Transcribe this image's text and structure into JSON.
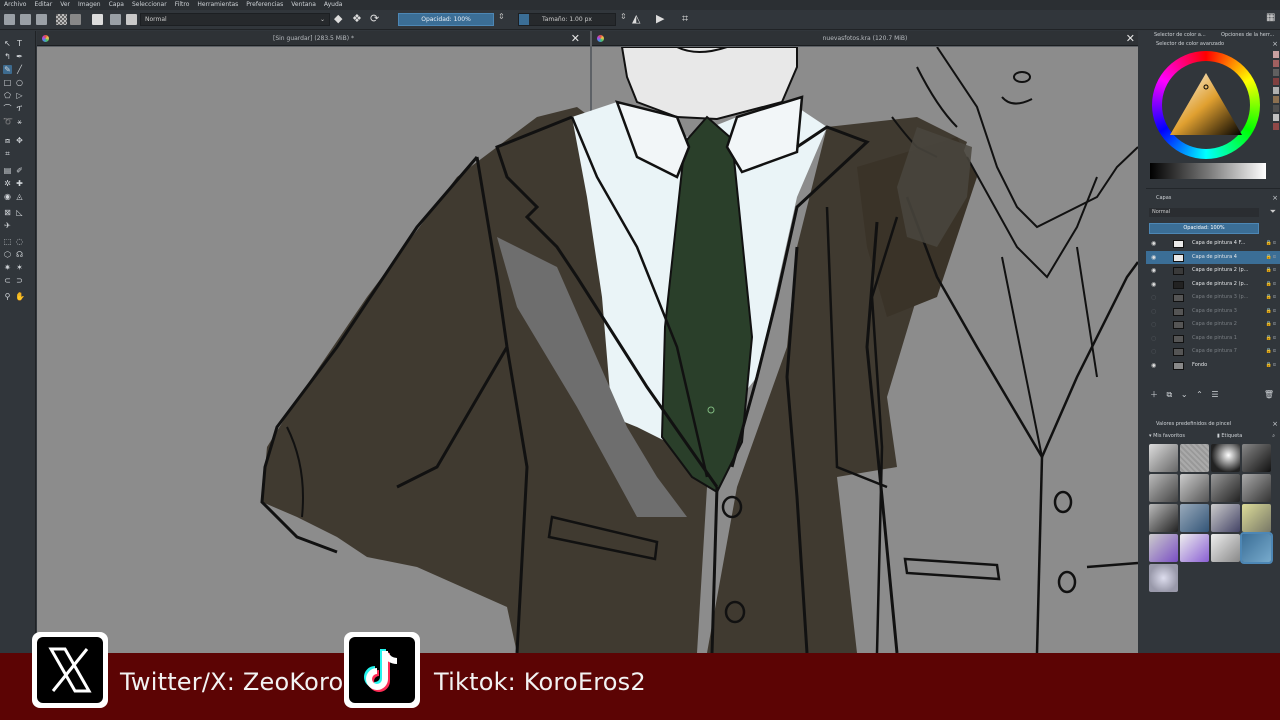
{
  "menubar": {
    "items": [
      "Archivo",
      "Editar",
      "Ver",
      "Imagen",
      "Capa",
      "Seleccionar",
      "Filtro",
      "Herramientas",
      "Preferencias",
      "Ventana",
      "Ayuda"
    ]
  },
  "toolbar": {
    "blend_mode": "Normal",
    "opacity_label": "Opacidad: 100%",
    "size_label": "Tamaño: 1.00 px"
  },
  "views": [
    {
      "title": "[Sin guardar]  (283.5 MiB) *",
      "close": "✕"
    },
    {
      "title": "nuevasfotos.kra  (120.7 MiB)",
      "close": "✕"
    }
  ],
  "color_docker": {
    "tabs": [
      "Selector de color a...",
      "Opciones de la herr..."
    ],
    "header": "Selector de color avanzado",
    "swatches": [
      "#c8a0a0",
      "#a06060",
      "#606060",
      "#804040",
      "#b0b0b0",
      "#8c7050",
      "#505050",
      "#c0c0c0",
      "#904848"
    ]
  },
  "layers_docker": {
    "title": "Capas",
    "blend": "Normal",
    "opacity": "Opacidad:  100%",
    "layers": [
      {
        "name": "Capa de pintura 4 F...",
        "visible": true,
        "selected": false,
        "dim": false
      },
      {
        "name": "Capa de pintura 4",
        "visible": true,
        "selected": true,
        "dim": false
      },
      {
        "name": "Capa de pintura 2 (p...",
        "visible": true,
        "selected": false,
        "dim": false
      },
      {
        "name": "Capa de pintura 2 (p...",
        "visible": true,
        "selected": false,
        "dim": false
      },
      {
        "name": "Capa de pintura 3 (p...",
        "visible": false,
        "selected": false,
        "dim": true
      },
      {
        "name": "Capa de pintura 3",
        "visible": false,
        "selected": false,
        "dim": true
      },
      {
        "name": "Capa de pintura 2",
        "visible": false,
        "selected": false,
        "dim": true
      },
      {
        "name": "Capa de pintura 1",
        "visible": false,
        "selected": false,
        "dim": true
      },
      {
        "name": "Capa de pintura 7",
        "visible": false,
        "selected": false,
        "dim": true
      },
      {
        "name": "Fondo",
        "visible": true,
        "selected": false,
        "dim": false
      }
    ]
  },
  "presets_docker": {
    "title": "Valores predefinidos de pincel",
    "filter": "Mis favoritos",
    "tag_label": "Etiqueta",
    "brushes": [
      "ink",
      "pencil",
      "airbrush",
      "marker",
      "pen",
      "eraser",
      "smudge",
      "fine",
      "fill",
      "blend",
      "wet",
      "texture",
      "violet",
      "violet2",
      "bristle",
      "fill-bucket",
      "sparkle"
    ]
  },
  "banner": {
    "twitter": "Twitter/X: ZeoKoro",
    "tiktok": "Tiktok: KoroEros2"
  },
  "colors": {
    "banner_bg": "#5c0404",
    "jacket": "#403a30",
    "tie": "#2a3f2a",
    "canvas_bg": "#8c8c8c",
    "accent": "#3b6e96"
  }
}
